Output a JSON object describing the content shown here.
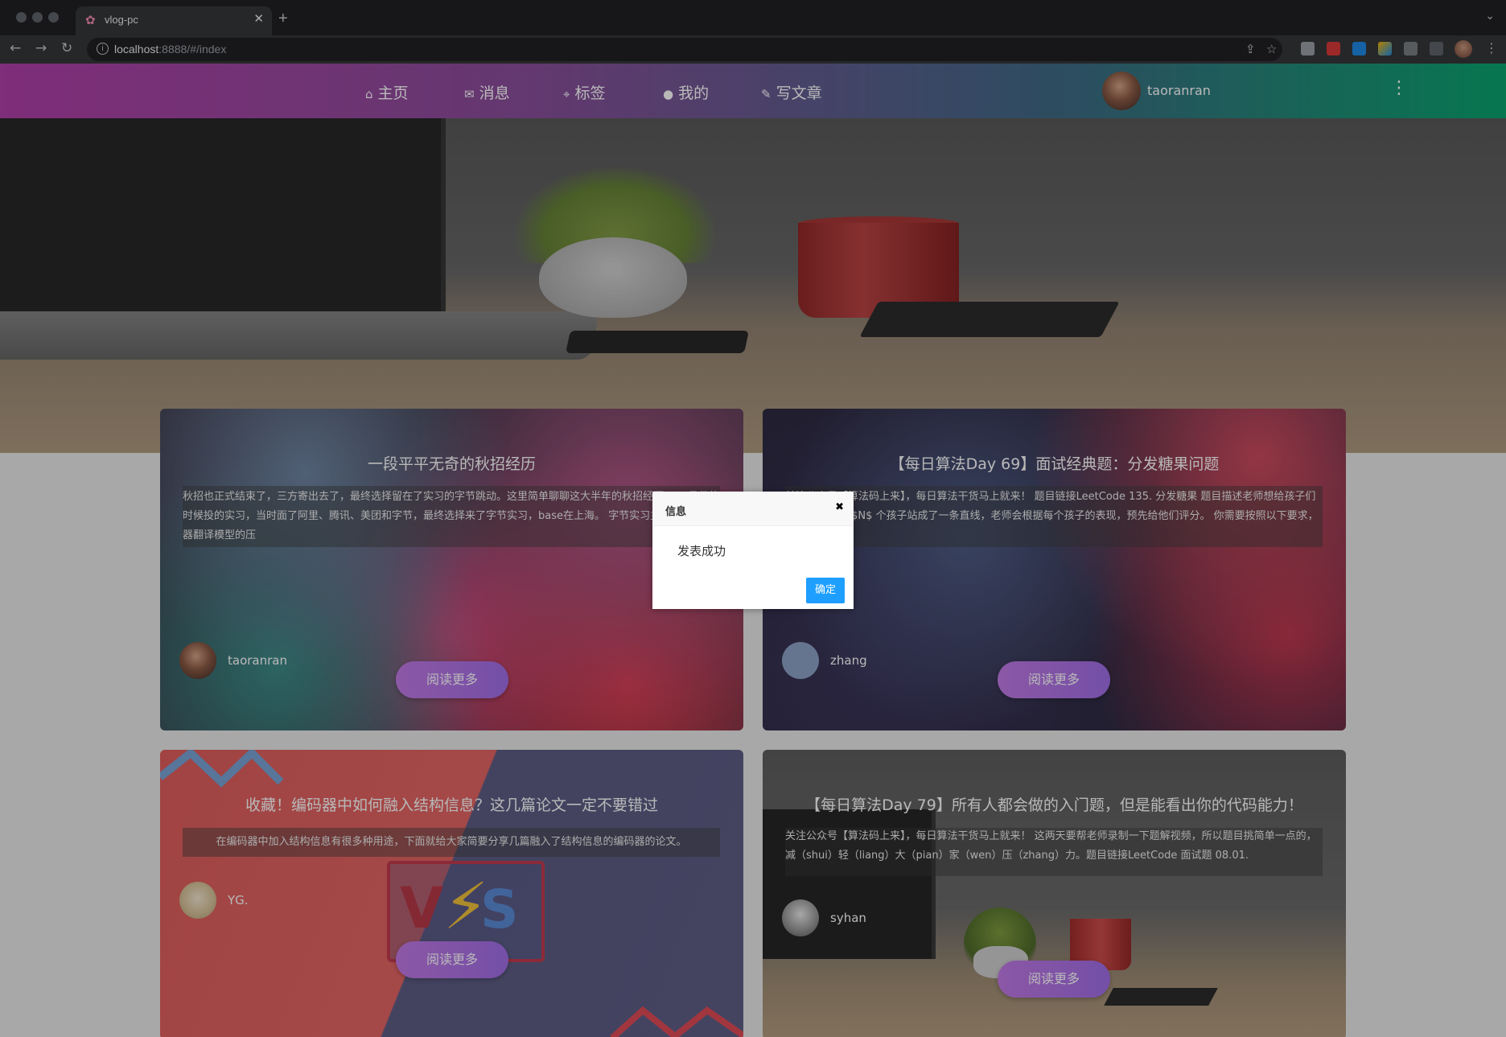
{
  "browser": {
    "tab_title": "vlog-pc",
    "tab_close": "✕",
    "new_tab": "+",
    "url_host": "localhost",
    "url_rest": ":8888/#/index"
  },
  "header": {
    "nav": [
      {
        "icon": "home-icon",
        "glyph": "⌂",
        "label": "主页"
      },
      {
        "icon": "message-icon",
        "glyph": "✉",
        "label": "消息"
      },
      {
        "icon": "tag-icon",
        "glyph": "⌖",
        "label": "标签"
      },
      {
        "icon": "user-icon",
        "glyph": "●",
        "label": "我的"
      },
      {
        "icon": "pencil-icon",
        "glyph": "✎",
        "label": "写文章"
      }
    ],
    "username": "taoranran",
    "more_glyph": "⋮",
    "gradient": [
      "#b040a8",
      "#0aa56f"
    ]
  },
  "carousel": {
    "dot_count": 6
  },
  "cards": [
    {
      "title": "一段平平无奇的秋招经历",
      "summary": "秋招也正式结束了，三方寄出去了，最终选择留在了实习的字节跳动。这里简单聊聊这大半年的秋招经历。 四月份的时候投的实习，当时面了阿里、腾讯、美团和字节，最终选择来了字节实习，base在上海。 字节实习主要做的是机器翻译模型的压",
      "author": "taoranran",
      "button": "阅读更多"
    },
    {
      "title": "【每日算法Day 69】面试经典题：分发糖果问题",
      "summary": "关注公众号【算法码上来】，每日算法干货马上就来！ 题目链接LeetCode 135. 分发糖果 题目描述老师想给孩子们分发糖果，有 $N$ 个孩子站成了一条直线，老师会根据每个孩子的表现，预先给他们评分。 你需要按照以下要求，帮助老师",
      "author": "zhang",
      "button": "阅读更多"
    },
    {
      "title": "收藏！编码器中如何融入结构信息？这几篇论文一定不要错过",
      "summary": "在编码器中加入结构信息有很多种用途，下面就给大家简要分享几篇融入了结构信息的编码器的论文。",
      "author": "YG.",
      "button": "阅读更多"
    },
    {
      "title": "【每日算法Day 79】所有人都会做的入门题，但是能看出你的代码能力！",
      "summary": "关注公众号【算法码上来】，每日算法干货马上就来！ 这两天要帮老师录制一下题解视频，所以题目挑简单一点的，减（shui）轻（liang）大（pian）家（wen）压（zhang）力。题目链接LeetCode 面试题 08.01.",
      "author": "syhan",
      "button": "阅读更多"
    }
  ],
  "dialog": {
    "title": "信息",
    "close": "✖",
    "message": "发表成功",
    "ok": "确定",
    "ok_color": "#1e9fff"
  }
}
